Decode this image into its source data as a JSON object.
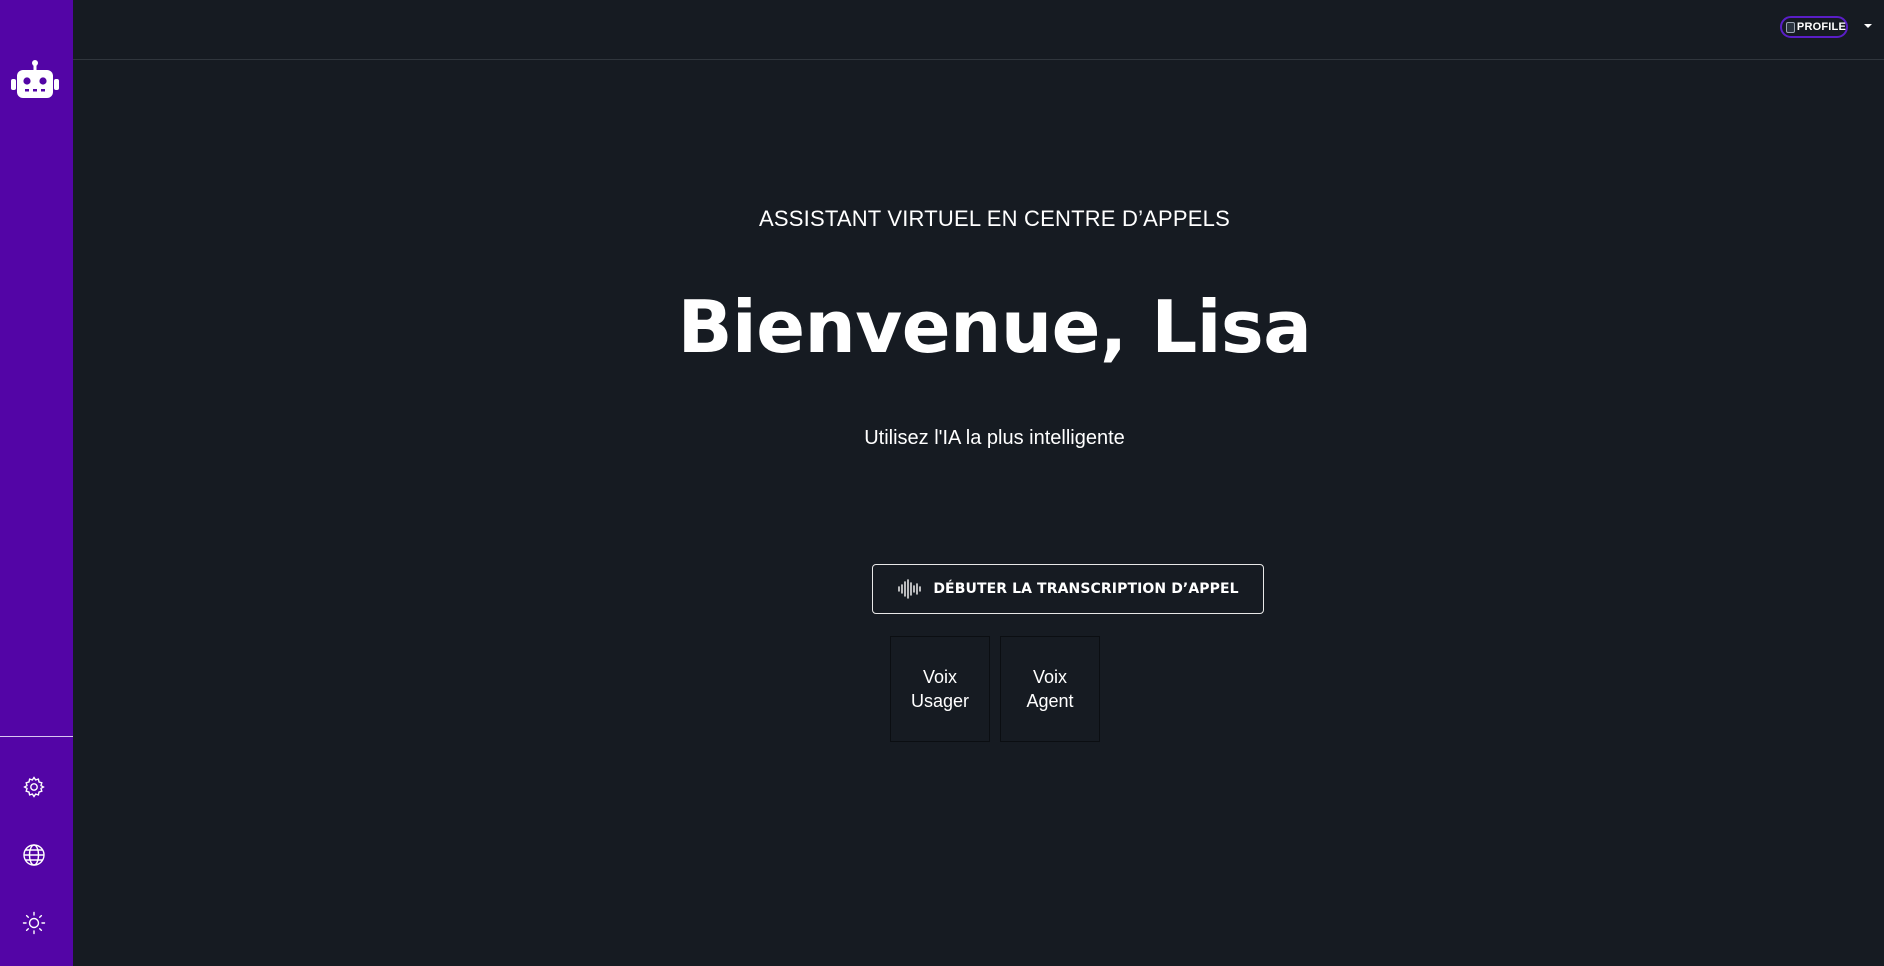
{
  "sidebar": {
    "logo_icon": "robot-icon",
    "buttons": [
      {
        "icon": "gear-icon",
        "name": "settings"
      },
      {
        "icon": "globe-icon",
        "name": "language"
      },
      {
        "icon": "sun-icon",
        "name": "theme"
      }
    ]
  },
  "header": {
    "profile_alt": "PROFILE"
  },
  "main": {
    "eyebrow": "ASSISTANT VIRTUEL EN CENTRE D’APPELS",
    "welcome": "Bienvenue, Lisa",
    "tagline": "Utilisez l'IA la plus intelligente",
    "cta_label": "DÉBUTER LA TRANSCRIPTION D’APPEL",
    "cta_icon": "audio-wave-icon",
    "voice_user": "Voix Usager",
    "voice_agent": "Voix Agent"
  },
  "colors": {
    "sidebar": "#5305a6",
    "background": "#161b22",
    "text": "#ffffff",
    "profile_border": "#5a1ec7"
  }
}
